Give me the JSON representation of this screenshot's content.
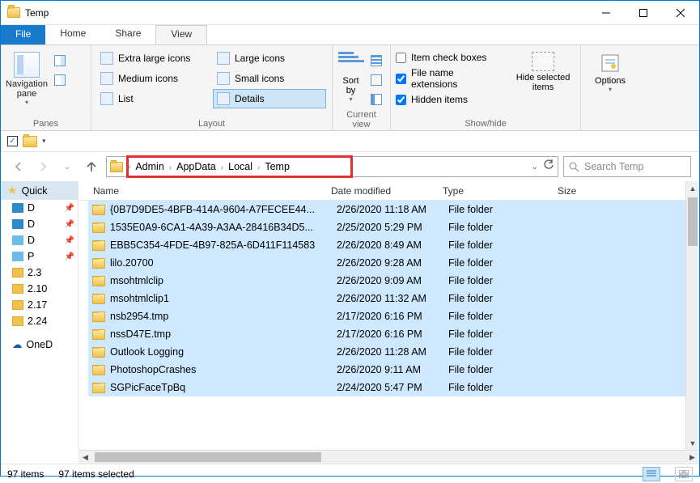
{
  "window": {
    "title": "Temp"
  },
  "menubar": {
    "file": "File",
    "home": "Home",
    "share": "Share",
    "view": "View"
  },
  "ribbon": {
    "panes": {
      "label": "Panes",
      "navpane": "Navigation pane"
    },
    "layout": {
      "label": "Layout",
      "opts": [
        "Extra large icons",
        "Large icons",
        "Medium icons",
        "Small icons",
        "List",
        "Details"
      ]
    },
    "sortby": {
      "label": "Sort by"
    },
    "curview": {
      "label": "Current view"
    },
    "showhide": {
      "label": "Show/hide",
      "item_check": "Item check boxes",
      "file_ext": "File name extensions",
      "hidden": "Hidden items",
      "hidesel": "Hide selected items"
    },
    "options": {
      "label": "Options"
    }
  },
  "breadcrumb": [
    "Admin",
    "AppData",
    "Local",
    "Temp"
  ],
  "search": {
    "placeholder": "Search Temp"
  },
  "columns": {
    "name": "Name",
    "date": "Date modified",
    "type": "Type",
    "size": "Size"
  },
  "sidebar": {
    "quick": "Quick",
    "items": [
      "D",
      "D",
      "D",
      "P",
      "2.3",
      "2.10",
      "2.17",
      "2.24"
    ],
    "onedrive": "OneD"
  },
  "files": [
    {
      "name": "{0B7D9DE5-4BFB-414A-9604-A7FECEE44...",
      "date": "2/26/2020 11:18 AM",
      "type": "File folder"
    },
    {
      "name": "1535E0A9-6CA1-4A39-A3AA-28416B34D5...",
      "date": "2/25/2020 5:29 PM",
      "type": "File folder"
    },
    {
      "name": "EBB5C354-4FDE-4B97-825A-6D411F114583",
      "date": "2/26/2020 8:49 AM",
      "type": "File folder"
    },
    {
      "name": "lilo.20700",
      "date": "2/26/2020 9:28 AM",
      "type": "File folder"
    },
    {
      "name": "msohtmlclip",
      "date": "2/26/2020 9:09 AM",
      "type": "File folder"
    },
    {
      "name": "msohtmlclip1",
      "date": "2/26/2020 11:32 AM",
      "type": "File folder"
    },
    {
      "name": "nsb2954.tmp",
      "date": "2/17/2020 6:16 PM",
      "type": "File folder"
    },
    {
      "name": "nssD47E.tmp",
      "date": "2/17/2020 6:16 PM",
      "type": "File folder"
    },
    {
      "name": "Outlook Logging",
      "date": "2/26/2020 11:28 AM",
      "type": "File folder"
    },
    {
      "name": "PhotoshopCrashes",
      "date": "2/26/2020 9:11 AM",
      "type": "File folder"
    },
    {
      "name": "SGPicFaceTpBq",
      "date": "2/24/2020 5:47 PM",
      "type": "File folder"
    }
  ],
  "status": {
    "count": "97 items",
    "selected": "97 items selected"
  }
}
